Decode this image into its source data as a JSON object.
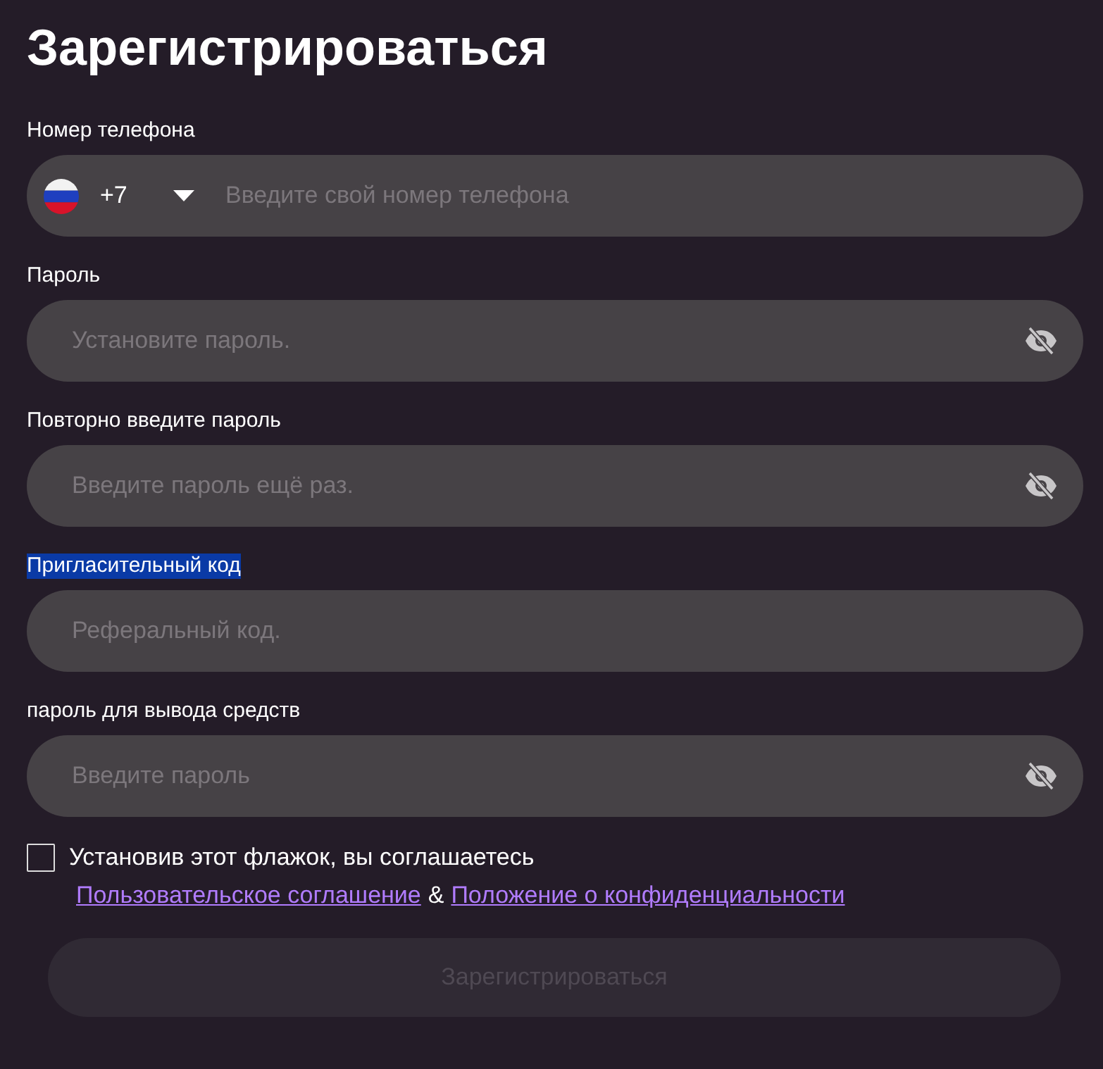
{
  "title": "Зарегистрироваться",
  "fields": [
    {
      "kind": "phone",
      "label": "Номер телефона",
      "highlighted": false,
      "code": "+7",
      "placeholder": "Введите свой номер телефона"
    },
    {
      "kind": "password",
      "label": "Пароль",
      "highlighted": false,
      "placeholder": "Установите пароль."
    },
    {
      "kind": "password",
      "label": "Повторно введите пароль",
      "highlighted": false,
      "placeholder": "Введите пароль ещё раз."
    },
    {
      "kind": "text",
      "label": "Пригласительный код",
      "highlighted": true,
      "placeholder": "Реферальный код."
    },
    {
      "kind": "password",
      "label": "пароль для вывода средств",
      "highlighted": false,
      "placeholder": "Введите пароль"
    }
  ],
  "agreement": {
    "checked": false,
    "text": "Установив этот флажок, вы соглашаетесь",
    "links": [
      "Пользовательское соглашение",
      "Положение о конфиденциальности"
    ],
    "separator": "&"
  },
  "submit": {
    "label": "Зарегистрироваться",
    "disabled": true
  }
}
